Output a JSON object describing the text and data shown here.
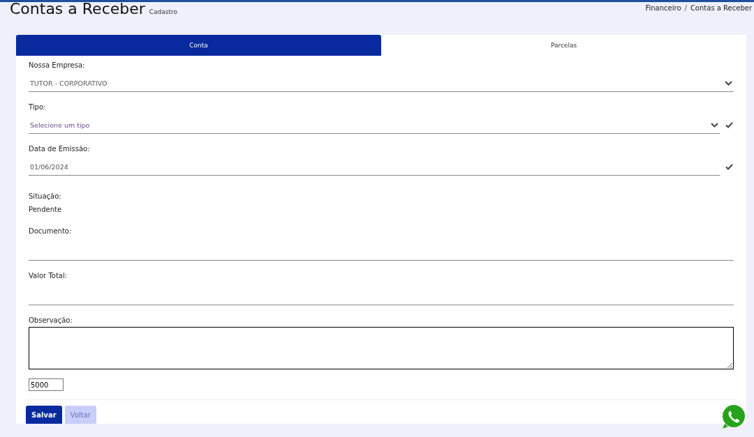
{
  "header": {
    "title": "Contas a Receber",
    "subtitle": "Cadastro",
    "breadcrumb": [
      "Financeiro",
      "Contas a Receber"
    ],
    "breadcrumb_separator": "/"
  },
  "tabs": [
    {
      "label": "Conta",
      "selected": true
    },
    {
      "label": "Parcelas",
      "selected": false
    }
  ],
  "fields": [
    {
      "kind": "select",
      "label": "Nossa Empresa:",
      "value": "TUTOR - CORPORATIVO",
      "validated": false
    },
    {
      "kind": "select",
      "label": "Tipo:",
      "placeholder": "Selecione um tipo",
      "validated": true
    },
    {
      "kind": "date",
      "label": "Data de Emissão:",
      "value": "01/06/2024",
      "validated": true
    },
    {
      "kind": "static",
      "label": "Situação:",
      "value": "Pendente"
    },
    {
      "kind": "text",
      "label": "Documento:"
    },
    {
      "kind": "text",
      "label": "Valor Total:"
    },
    {
      "kind": "textarea",
      "label": "Observação:",
      "counter": "5000"
    }
  ],
  "buttons": [
    {
      "label": "Salvar",
      "disabled": false
    },
    {
      "label": "Voltar",
      "disabled": true
    }
  ]
}
